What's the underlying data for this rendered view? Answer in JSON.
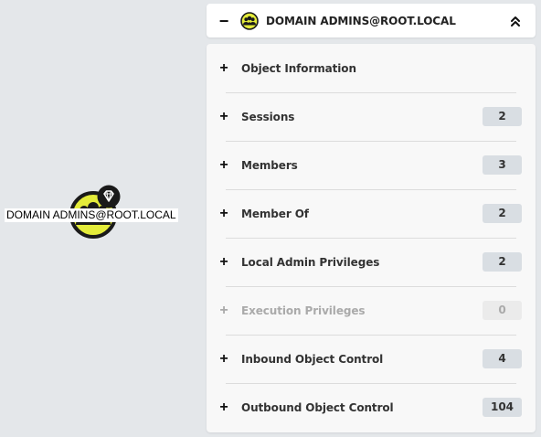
{
  "node": {
    "label": "DOMAIN ADMINS@ROOT.LOCAL",
    "glyph_icon": "group-icon",
    "badge_icon": "gem-icon"
  },
  "header": {
    "collapse_toggle": "−",
    "title": "DOMAIN ADMINS@ROOT.LOCAL",
    "group_icon": "group-icon",
    "collapse_icon": "double-chevron-up-icon"
  },
  "colors": {
    "node_fill": "#e4ec3a",
    "node_stroke": "#1a1a1a",
    "badge": "#1a1a1a",
    "count_badge": "#d9dee3",
    "page_bg": "#e4e7ea"
  },
  "sections": [
    {
      "toggle": "+",
      "label": "Object Information",
      "count": null,
      "disabled": false
    },
    {
      "toggle": "+",
      "label": "Sessions",
      "count": "2",
      "disabled": false
    },
    {
      "toggle": "+",
      "label": "Members",
      "count": "3",
      "disabled": false
    },
    {
      "toggle": "+",
      "label": "Member Of",
      "count": "2",
      "disabled": false
    },
    {
      "toggle": "+",
      "label": "Local Admin Privileges",
      "count": "2",
      "disabled": false
    },
    {
      "toggle": "+",
      "label": "Execution Privileges",
      "count": "0",
      "disabled": true
    },
    {
      "toggle": "+",
      "label": "Inbound Object Control",
      "count": "4",
      "disabled": false
    },
    {
      "toggle": "+",
      "label": "Outbound Object Control",
      "count": "104",
      "disabled": false
    }
  ]
}
